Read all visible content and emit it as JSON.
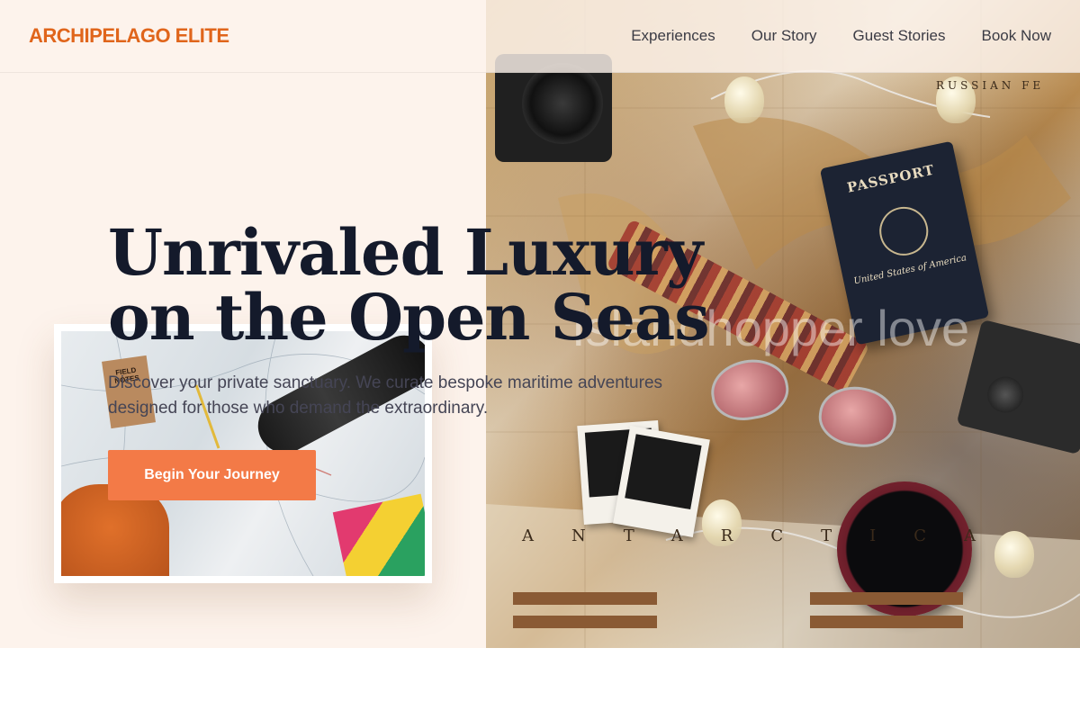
{
  "header": {
    "brand": "ARCHIPELAGO ELITE",
    "nav": [
      {
        "label": "Experiences"
      },
      {
        "label": "Our Story"
      },
      {
        "label": "Guest Stories"
      },
      {
        "label": "Book Now"
      }
    ]
  },
  "hero": {
    "headline_line1": "Unrivaled Luxury",
    "headline_line2": "on the Open Seas",
    "subtitle": "Discover your private sanctuary. We curate bespoke maritime adventures designed for those who demand the extraordinary.",
    "cta_label": "Begin Your Journey",
    "watermark": "Islandhopper love"
  },
  "photos": {
    "right_photo": {
      "passport_title": "PASSPORT",
      "passport_country": "United States of America",
      "map_text_top": "RUSSIAN FE",
      "map_text_bottom": "ANTARCTICA"
    },
    "left_photo": {
      "notebook_label": "FIELD NOTES"
    }
  },
  "colors": {
    "brand": "#e0651b",
    "cta": "#f37a47",
    "hero_bg": "#fdf3ec",
    "headline": "#141a2b"
  }
}
